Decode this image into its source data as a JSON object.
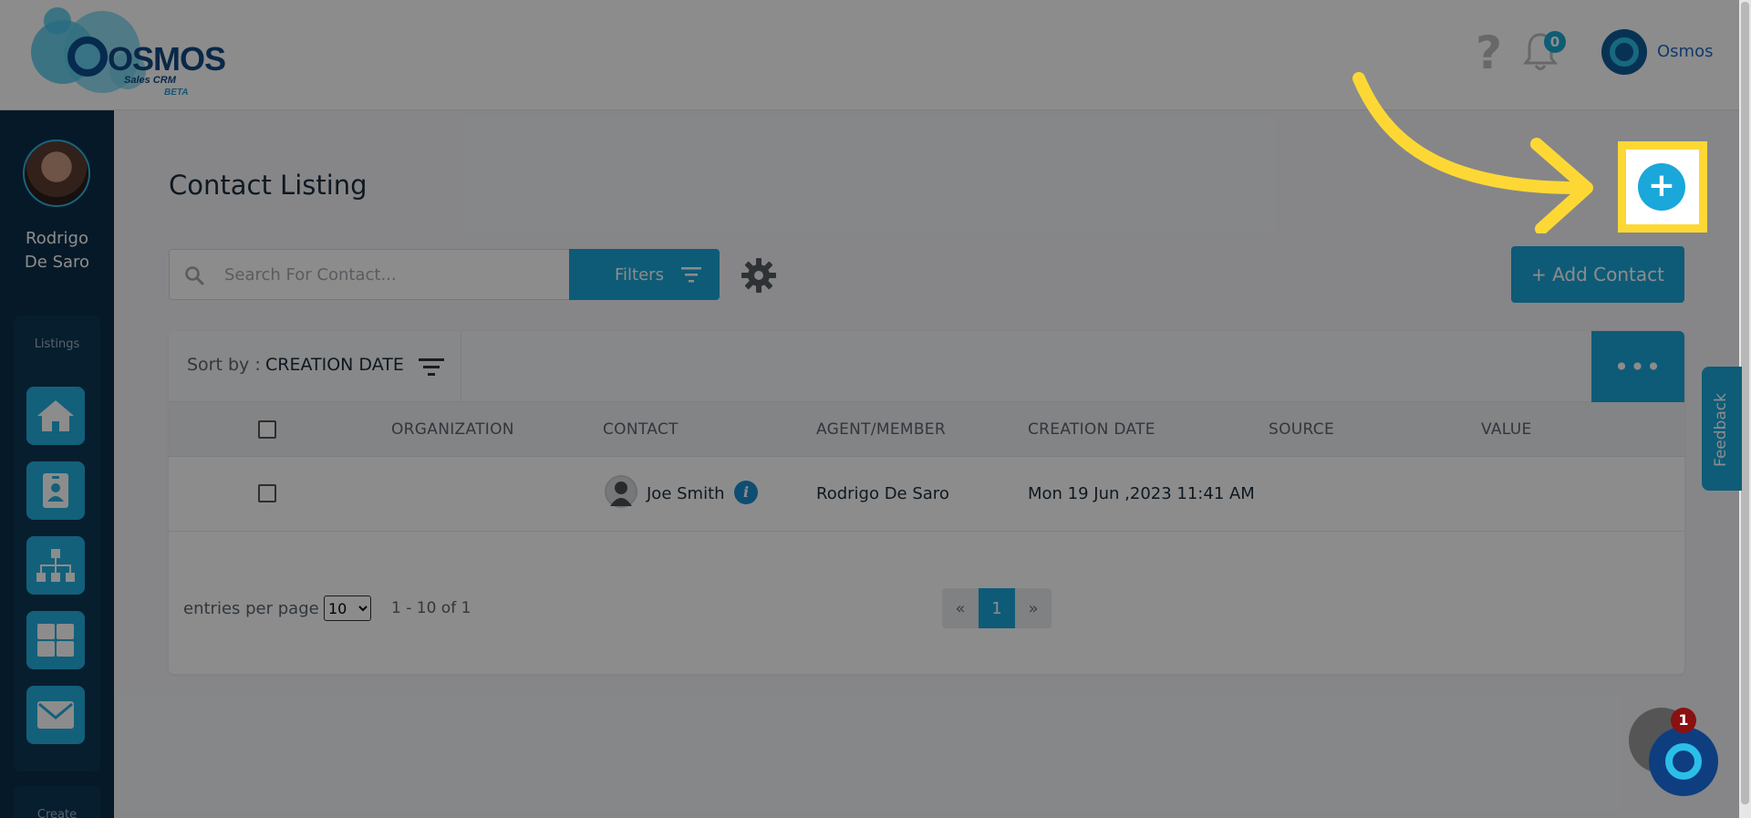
{
  "header": {
    "logo_text": "OSMOS",
    "logo_subtitle": "Sales CRM",
    "logo_badge": "BETA",
    "notifications_count": "0",
    "help_glyph": "?",
    "user_name": "Osmos"
  },
  "sidebar": {
    "profile_name_line1": "Rodrigo",
    "profile_name_line2": "De Saro",
    "section_label": "Listings",
    "items": [
      {
        "icon": "home-icon"
      },
      {
        "icon": "contact-card-icon"
      },
      {
        "icon": "org-chart-icon"
      },
      {
        "icon": "grid-icon"
      },
      {
        "icon": "mail-icon"
      }
    ],
    "create_label": "Create"
  },
  "main": {
    "title": "Contact Listing",
    "search": {
      "placeholder": "Search For Contact...",
      "value": ""
    },
    "filters_label": "Filters",
    "add_contact_label": "+ Add Contact",
    "sort_label": "Sort by :",
    "sort_value": "CREATION DATE",
    "more_label": "•••",
    "columns": [
      "ORGANIZATION",
      "CONTACT",
      "AGENT/MEMBER",
      "CREATION DATE",
      "SOURCE",
      "VALUE"
    ],
    "rows": [
      {
        "organization": "",
        "contact": "Joe Smith",
        "agent": "Rodrigo De Saro",
        "creation_date": "Mon 19 Jun ,2023 11:41 AM",
        "source": "",
        "value": ""
      }
    ],
    "entries_label": "entries per page",
    "entries_value": "10",
    "range_text": "1 - 10 of 1",
    "pager": {
      "prev": "«",
      "current": "1",
      "next": "»"
    }
  },
  "overlay": {
    "feedback_label": "Feedback",
    "highlight_button_glyph": "+",
    "chat_badge": "1",
    "colors": {
      "highlight": "#fdd834",
      "accent": "#1aa7d9"
    }
  }
}
